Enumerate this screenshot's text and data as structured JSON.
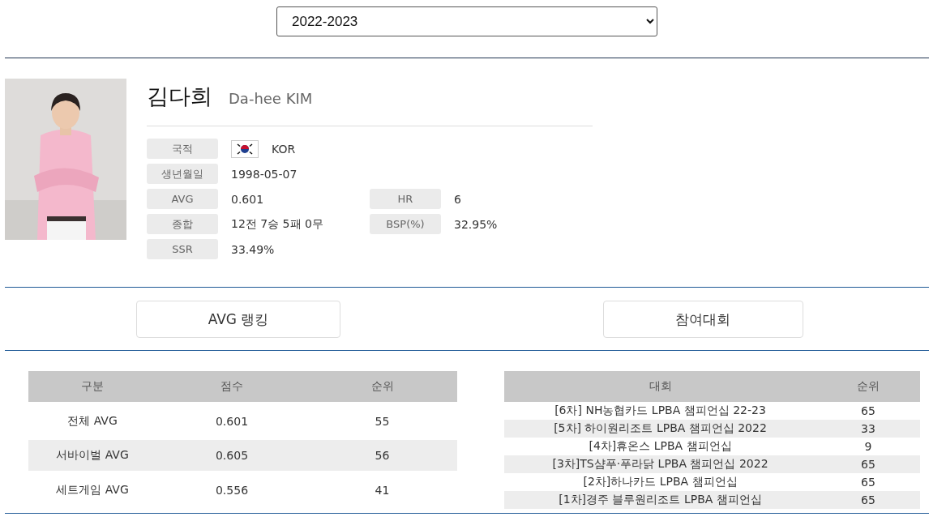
{
  "season_select": {
    "value": "2022-2023"
  },
  "profile": {
    "photo": {
      "kind": "picture"
    },
    "name_ko": "김다희",
    "name_en": "Da-hee KIM",
    "rows": [
      [
        {
          "label": "국적",
          "value": "KOR",
          "kind": "flag"
        }
      ],
      [
        {
          "label": "생년월일",
          "value": "1998-05-07",
          "kind": "text"
        }
      ],
      [
        {
          "label": "AVG",
          "value": "0.601",
          "kind": "text"
        },
        {
          "label": "HR",
          "value": "6",
          "kind": "text"
        }
      ],
      [
        {
          "label": "종합",
          "value": "12전 7승 5패 0무",
          "kind": "text"
        },
        {
          "label": "BSP(%)",
          "value": "32.95%",
          "kind": "text"
        }
      ],
      [
        {
          "label": "SSR",
          "value": "33.49%",
          "kind": "text"
        }
      ]
    ]
  },
  "buttons": [
    "AVG 랭킹",
    "참여대회"
  ],
  "avg_table": {
    "columns": [
      "구분",
      "점수",
      "순위"
    ],
    "rows": [
      [
        "전체 AVG",
        "0.601",
        "55"
      ],
      [
        "서바이벌 AVG",
        "0.605",
        "56"
      ],
      [
        "세트게임 AVG",
        "0.556",
        "41"
      ]
    ]
  },
  "tournament_table": {
    "columns": [
      "대회",
      "순위"
    ],
    "rows": [
      [
        "[6차] NH농협카드 LPBA 챔피언십 22-23",
        "65"
      ],
      [
        "[5차] 하이원리조트 LPBA 챔피언십 2022",
        "33"
      ],
      [
        "[4차]휴온스 LPBA 챔피언십",
        "9"
      ],
      [
        "[3차]TS샴푸·푸라닭 LPBA 챔피언십 2022",
        "65"
      ],
      [
        "[2차]하나카드 LPBA 챔피언십",
        "65"
      ],
      [
        "[1차]경주 블루원리조트 LPBA 챔피언십",
        "65"
      ]
    ]
  }
}
